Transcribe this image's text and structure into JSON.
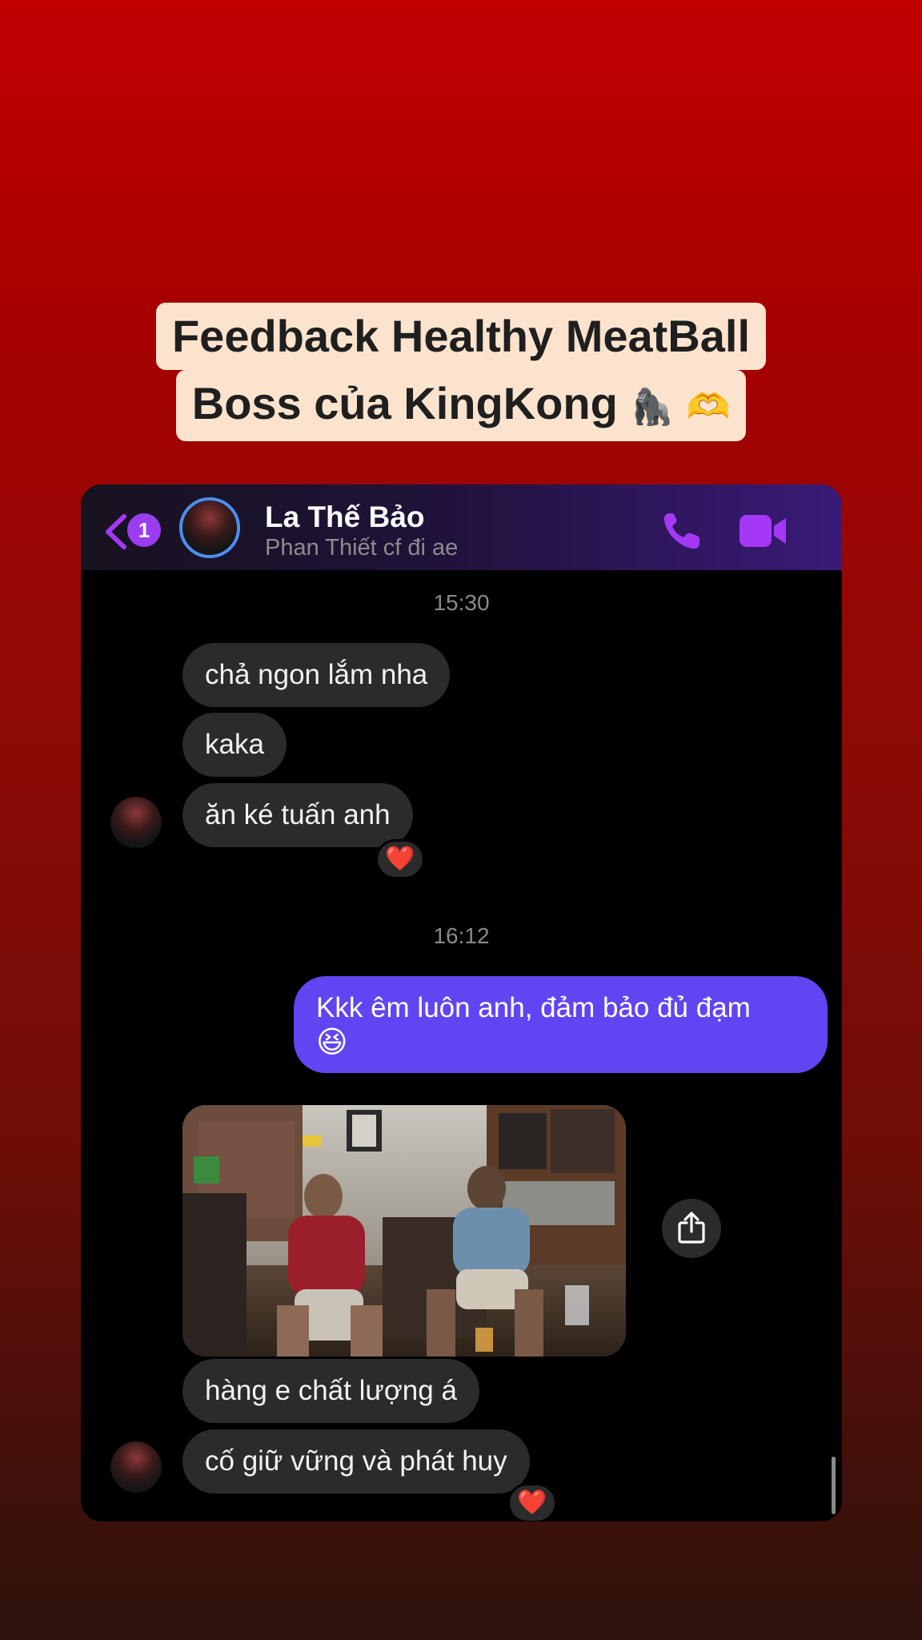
{
  "caption": {
    "line1": "Feedback Healthy MeatBall",
    "line2_text": "Boss của KingKong",
    "line2_emoji": "🦍 🫶"
  },
  "header": {
    "back_badge_count": "1",
    "contact_name": "La Thế Bảo",
    "contact_subtitle": "Phan Thiết cf đi ae"
  },
  "colors": {
    "accent": "#a438f5",
    "outgoing_bubble": "#6045f2",
    "incoming_bubble": "#2b2b2b"
  },
  "messages": {
    "time_1": "15:30",
    "in_1": "chả ngon lắm nha",
    "in_2": "kaka",
    "in_3": "ăn ké tuấn anh",
    "reaction_1": "❤️",
    "time_2": "16:12",
    "out_1": "Kkk êm luôn anh, đảm bảo đủ đạm",
    "out_1_emoji": "😆",
    "in_4": "hàng e chất lượng á",
    "in_5": "cố giữ vững và phát huy",
    "reaction_2": "❤️"
  },
  "icons": [
    "back-chevron-icon",
    "phone-icon",
    "video-camera-icon",
    "share-icon",
    "heart-icon"
  ]
}
